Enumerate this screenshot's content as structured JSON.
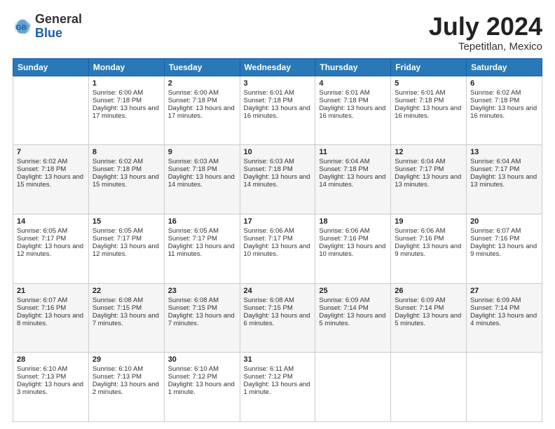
{
  "header": {
    "logo_general": "General",
    "logo_blue": "Blue",
    "month_title": "July 2024",
    "location": "Tepetitlan, Mexico"
  },
  "weekdays": [
    "Sunday",
    "Monday",
    "Tuesday",
    "Wednesday",
    "Thursday",
    "Friday",
    "Saturday"
  ],
  "weeks": [
    [
      {
        "day": "",
        "sunrise": "",
        "sunset": "",
        "daylight": ""
      },
      {
        "day": "1",
        "sunrise": "Sunrise: 6:00 AM",
        "sunset": "Sunset: 7:18 PM",
        "daylight": "Daylight: 13 hours and 17 minutes."
      },
      {
        "day": "2",
        "sunrise": "Sunrise: 6:00 AM",
        "sunset": "Sunset: 7:18 PM",
        "daylight": "Daylight: 13 hours and 17 minutes."
      },
      {
        "day": "3",
        "sunrise": "Sunrise: 6:01 AM",
        "sunset": "Sunset: 7:18 PM",
        "daylight": "Daylight: 13 hours and 16 minutes."
      },
      {
        "day": "4",
        "sunrise": "Sunrise: 6:01 AM",
        "sunset": "Sunset: 7:18 PM",
        "daylight": "Daylight: 13 hours and 16 minutes."
      },
      {
        "day": "5",
        "sunrise": "Sunrise: 6:01 AM",
        "sunset": "Sunset: 7:18 PM",
        "daylight": "Daylight: 13 hours and 16 minutes."
      },
      {
        "day": "6",
        "sunrise": "Sunrise: 6:02 AM",
        "sunset": "Sunset: 7:18 PM",
        "daylight": "Daylight: 13 hours and 16 minutes."
      }
    ],
    [
      {
        "day": "7",
        "sunrise": "Sunrise: 6:02 AM",
        "sunset": "Sunset: 7:18 PM",
        "daylight": "Daylight: 13 hours and 15 minutes."
      },
      {
        "day": "8",
        "sunrise": "Sunrise: 6:02 AM",
        "sunset": "Sunset: 7:18 PM",
        "daylight": "Daylight: 13 hours and 15 minutes."
      },
      {
        "day": "9",
        "sunrise": "Sunrise: 6:03 AM",
        "sunset": "Sunset: 7:18 PM",
        "daylight": "Daylight: 13 hours and 14 minutes."
      },
      {
        "day": "10",
        "sunrise": "Sunrise: 6:03 AM",
        "sunset": "Sunset: 7:18 PM",
        "daylight": "Daylight: 13 hours and 14 minutes."
      },
      {
        "day": "11",
        "sunrise": "Sunrise: 6:04 AM",
        "sunset": "Sunset: 7:18 PM",
        "daylight": "Daylight: 13 hours and 14 minutes."
      },
      {
        "day": "12",
        "sunrise": "Sunrise: 6:04 AM",
        "sunset": "Sunset: 7:17 PM",
        "daylight": "Daylight: 13 hours and 13 minutes."
      },
      {
        "day": "13",
        "sunrise": "Sunrise: 6:04 AM",
        "sunset": "Sunset: 7:17 PM",
        "daylight": "Daylight: 13 hours and 13 minutes."
      }
    ],
    [
      {
        "day": "14",
        "sunrise": "Sunrise: 6:05 AM",
        "sunset": "Sunset: 7:17 PM",
        "daylight": "Daylight: 13 hours and 12 minutes."
      },
      {
        "day": "15",
        "sunrise": "Sunrise: 6:05 AM",
        "sunset": "Sunset: 7:17 PM",
        "daylight": "Daylight: 13 hours and 12 minutes."
      },
      {
        "day": "16",
        "sunrise": "Sunrise: 6:05 AM",
        "sunset": "Sunset: 7:17 PM",
        "daylight": "Daylight: 13 hours and 11 minutes."
      },
      {
        "day": "17",
        "sunrise": "Sunrise: 6:06 AM",
        "sunset": "Sunset: 7:17 PM",
        "daylight": "Daylight: 13 hours and 10 minutes."
      },
      {
        "day": "18",
        "sunrise": "Sunrise: 6:06 AM",
        "sunset": "Sunset: 7:16 PM",
        "daylight": "Daylight: 13 hours and 10 minutes."
      },
      {
        "day": "19",
        "sunrise": "Sunrise: 6:06 AM",
        "sunset": "Sunset: 7:16 PM",
        "daylight": "Daylight: 13 hours and 9 minutes."
      },
      {
        "day": "20",
        "sunrise": "Sunrise: 6:07 AM",
        "sunset": "Sunset: 7:16 PM",
        "daylight": "Daylight: 13 hours and 9 minutes."
      }
    ],
    [
      {
        "day": "21",
        "sunrise": "Sunrise: 6:07 AM",
        "sunset": "Sunset: 7:16 PM",
        "daylight": "Daylight: 13 hours and 8 minutes."
      },
      {
        "day": "22",
        "sunrise": "Sunrise: 6:08 AM",
        "sunset": "Sunset: 7:15 PM",
        "daylight": "Daylight: 13 hours and 7 minutes."
      },
      {
        "day": "23",
        "sunrise": "Sunrise: 6:08 AM",
        "sunset": "Sunset: 7:15 PM",
        "daylight": "Daylight: 13 hours and 7 minutes."
      },
      {
        "day": "24",
        "sunrise": "Sunrise: 6:08 AM",
        "sunset": "Sunset: 7:15 PM",
        "daylight": "Daylight: 13 hours and 6 minutes."
      },
      {
        "day": "25",
        "sunrise": "Sunrise: 6:09 AM",
        "sunset": "Sunset: 7:14 PM",
        "daylight": "Daylight: 13 hours and 5 minutes."
      },
      {
        "day": "26",
        "sunrise": "Sunrise: 6:09 AM",
        "sunset": "Sunset: 7:14 PM",
        "daylight": "Daylight: 13 hours and 5 minutes."
      },
      {
        "day": "27",
        "sunrise": "Sunrise: 6:09 AM",
        "sunset": "Sunset: 7:14 PM",
        "daylight": "Daylight: 13 hours and 4 minutes."
      }
    ],
    [
      {
        "day": "28",
        "sunrise": "Sunrise: 6:10 AM",
        "sunset": "Sunset: 7:13 PM",
        "daylight": "Daylight: 13 hours and 3 minutes."
      },
      {
        "day": "29",
        "sunrise": "Sunrise: 6:10 AM",
        "sunset": "Sunset: 7:13 PM",
        "daylight": "Daylight: 13 hours and 2 minutes."
      },
      {
        "day": "30",
        "sunrise": "Sunrise: 6:10 AM",
        "sunset": "Sunset: 7:12 PM",
        "daylight": "Daylight: 13 hours and 1 minute."
      },
      {
        "day": "31",
        "sunrise": "Sunrise: 6:11 AM",
        "sunset": "Sunset: 7:12 PM",
        "daylight": "Daylight: 13 hours and 1 minute."
      },
      {
        "day": "",
        "sunrise": "",
        "sunset": "",
        "daylight": ""
      },
      {
        "day": "",
        "sunrise": "",
        "sunset": "",
        "daylight": ""
      },
      {
        "day": "",
        "sunrise": "",
        "sunset": "",
        "daylight": ""
      }
    ]
  ]
}
